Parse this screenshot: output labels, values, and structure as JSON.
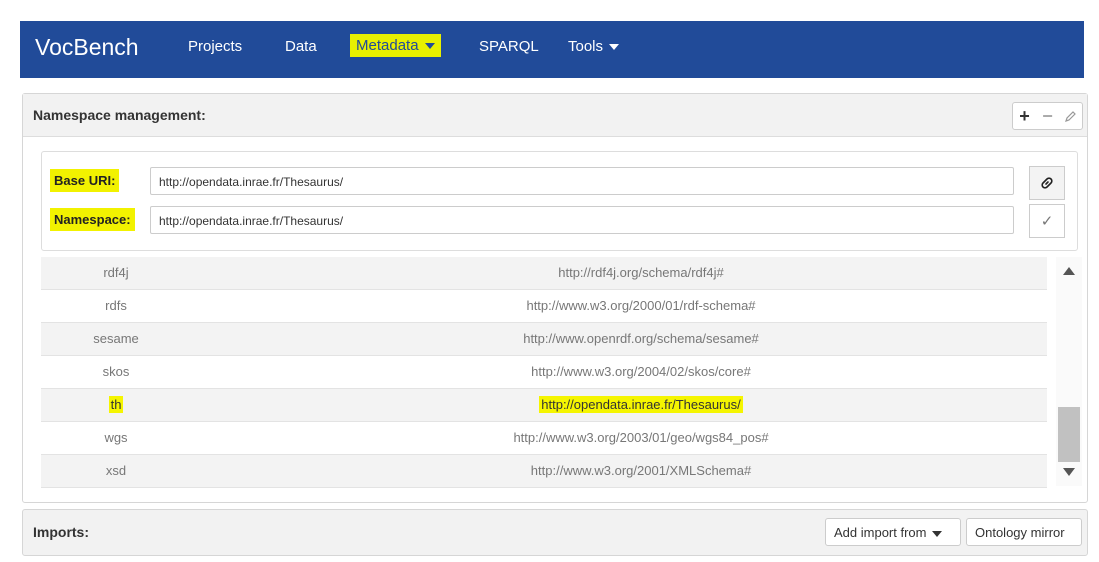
{
  "navbar": {
    "brand": "VocBench",
    "items": [
      "Projects",
      "Data",
      "Metadata",
      "SPARQL",
      "Tools"
    ]
  },
  "namespace_panel": {
    "title": "Namespace management:",
    "base_uri_label": "Base URI:",
    "base_uri_value": "http://opendata.inrae.fr/Thesaurus/",
    "namespace_label": "Namespace:",
    "namespace_value": "http://opendata.inrae.fr/Thesaurus/",
    "rows": [
      {
        "prefix": "rdf4j",
        "ns": "http://rdf4j.org/schema/rdf4j#"
      },
      {
        "prefix": "rdfs",
        "ns": "http://www.w3.org/2000/01/rdf-schema#"
      },
      {
        "prefix": "sesame",
        "ns": "http://www.openrdf.org/schema/sesame#"
      },
      {
        "prefix": "skos",
        "ns": "http://www.w3.org/2004/02/skos/core#"
      },
      {
        "prefix": "th",
        "ns": "http://opendata.inrae.fr/Thesaurus/"
      },
      {
        "prefix": "wgs",
        "ns": "http://www.w3.org/2003/01/geo/wgs84_pos#"
      },
      {
        "prefix": "xsd",
        "ns": "http://www.w3.org/2001/XMLSchema#"
      }
    ]
  },
  "imports_panel": {
    "title": "Imports:",
    "add_import_label": "Add import from",
    "ontology_mirror_label": "Ontology mirror"
  },
  "colors": {
    "navbar_bg": "#214b99",
    "highlight": "#f5f500"
  },
  "icons": [
    "add-icon",
    "remove-icon",
    "edit-icon",
    "link-icon",
    "check-icon",
    "caret-down-icon",
    "scroll-up-icon",
    "scroll-down-icon"
  ]
}
